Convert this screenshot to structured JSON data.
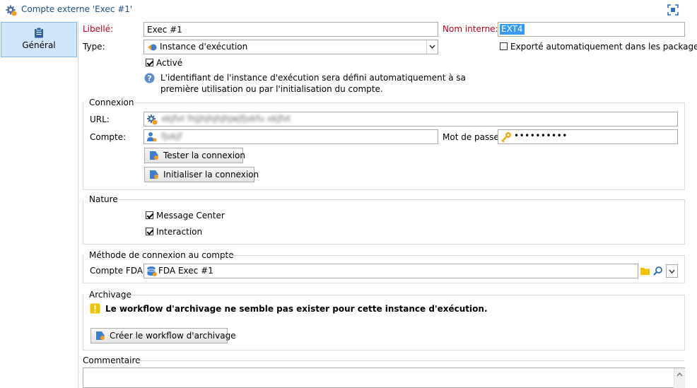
{
  "window": {
    "title": "Compte externe 'Exec #1'"
  },
  "sidebar": {
    "items": [
      {
        "label": "Général",
        "icon": "clipboard-icon",
        "selected": true
      }
    ]
  },
  "general": {
    "libelle_label": "Libellé:",
    "libelle_value": "Exec #1",
    "nom_interne_label": "Nom interne:",
    "nom_interne_value": "EXT4",
    "type_label": "Type:",
    "type_value": "Instance d'exécution",
    "exporte_label": "Exporté automatiquement dans les packages",
    "exporte_checked": false,
    "active_label": "Activé",
    "active_checked": true,
    "info_text_line1": "L'identifiant de l'instance d'exécution sera défini automatiquement à sa",
    "info_text_line2": "première utilisation ou par l'initialisation du compte."
  },
  "connexion": {
    "section_title": "Connexion",
    "url_label": "URL:",
    "url_value": "xkjfvt fnjjhjhjhjhjwjfjvkfu xkjfvt",
    "compte_label": "Compte:",
    "compte_value": "fjvkjf",
    "mot_de_passe_label": "Mot de passe:",
    "mot_de_passe_value": "••••••••••",
    "tester_button": "Tester la connexion",
    "initialiser_button": "Initialiser la connexion"
  },
  "nature": {
    "section_title": "Nature",
    "options": [
      {
        "label": "Message Center",
        "checked": true
      },
      {
        "label": "Interaction",
        "checked": true
      }
    ]
  },
  "methode": {
    "section_title": "Méthode de connexion au compte",
    "compte_fda_label": "Compte FDA:",
    "compte_fda_value": "FDA Exec #1"
  },
  "archivage": {
    "section_title": "Archivage",
    "warning_text": "Le workflow d'archivage ne semble pas exister pour cette instance d'exécution.",
    "create_button": "Créer le workflow d'archivage"
  },
  "commentaire": {
    "section_title": "Commentaire",
    "value": ""
  },
  "colors": {
    "required_label": "#c0001c",
    "selected_tab_bg": "#cfe6fb",
    "title_text": "#1f4e79",
    "warning": "#f2c200"
  }
}
